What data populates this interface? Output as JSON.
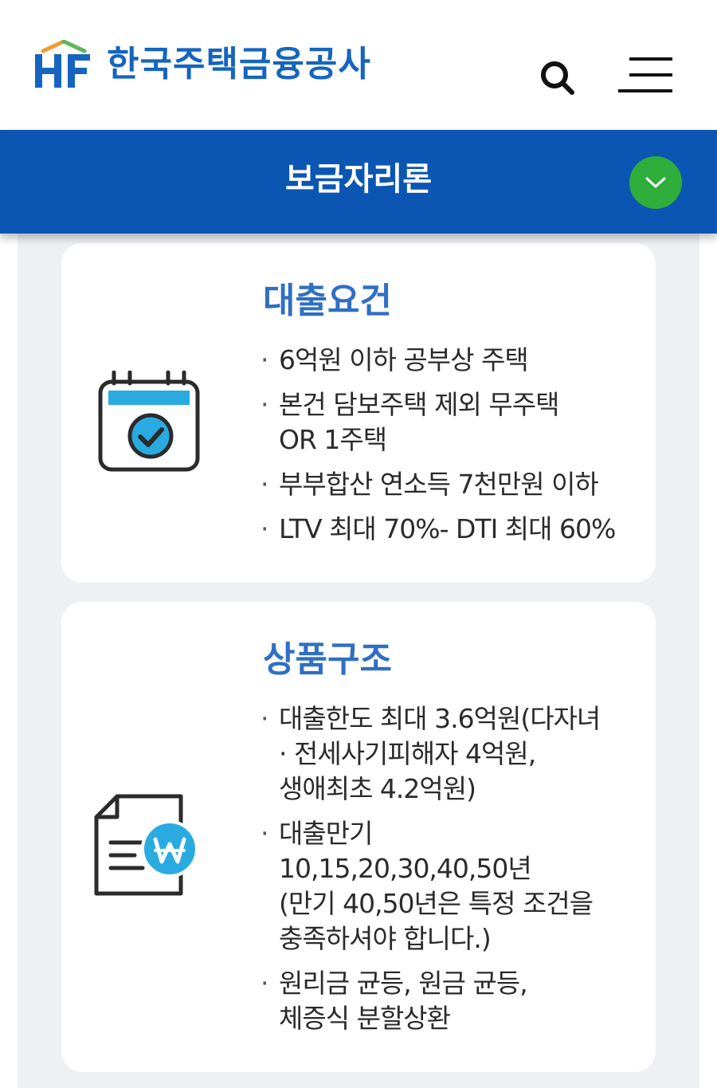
{
  "header": {
    "logo_letters": "HF",
    "org_name": "한국주택금융공사",
    "icons": {
      "search": "search-icon",
      "menu": "hamburger-menu-icon"
    },
    "brand_color": "#1565c0",
    "logo_roof_colors": [
      "#f29a2e",
      "#5cb85c"
    ]
  },
  "subbar": {
    "title": "보금자리론",
    "bar_color": "#0b56b3",
    "dropdown_color": "#2fae3c",
    "dropdown_icon": "chevron-down-icon"
  },
  "cards": [
    {
      "icon": "calendar-check-icon",
      "title": "대출요건",
      "bullets": [
        {
          "lines": [
            "6억원 이하 공부상 주택"
          ]
        },
        {
          "lines": [
            "본건 담보주택 제외 무주택",
            "OR 1주택"
          ]
        },
        {
          "lines": [
            "부부합산 연소득 7천만원 이하"
          ]
        },
        {
          "lines": [
            "LTV 최대 70%- DTI 최대 60%"
          ]
        }
      ]
    },
    {
      "icon": "document-won-icon",
      "title": "상품구조",
      "bullets": [
        {
          "lines": [
            "대출한도 최대 3.6억원(다자녀",
            "· 전세사기피해자 4억원,",
            "생애최초 4.2억원)"
          ]
        },
        {
          "lines": [
            "대출만기",
            "10,15,20,30,40,50년",
            "(만기 40,50년은 특정 조건을",
            "충족하셔야 합니다.)"
          ]
        },
        {
          "lines": [
            "원리금 균등, 원금 균등,",
            "체증식 분할상환"
          ]
        }
      ]
    }
  ],
  "colors": {
    "title_accent": "#2f6fc4",
    "icon_accent": "#29abe2",
    "page_bg": "#eef0f4"
  }
}
